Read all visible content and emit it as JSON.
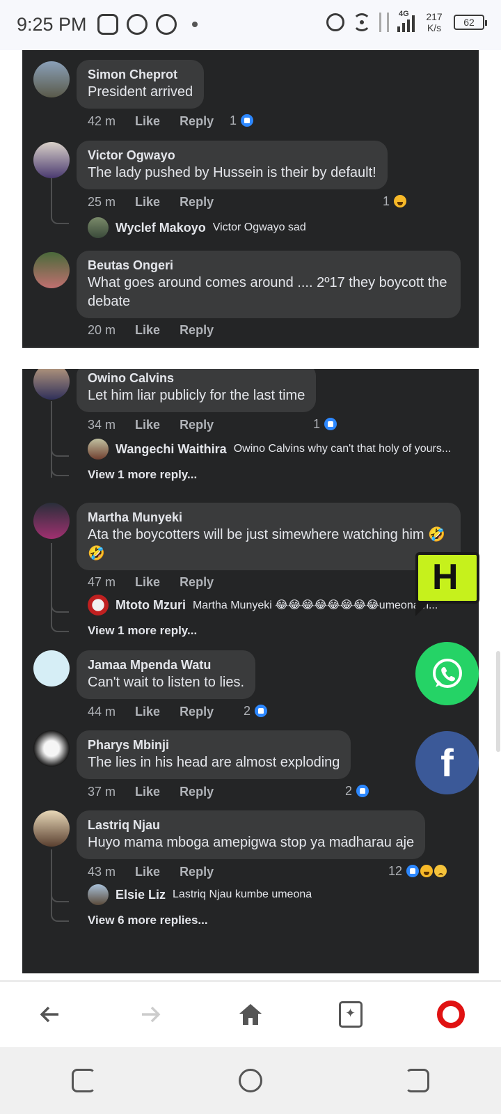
{
  "status_bar": {
    "time": "9:25 PM",
    "network": "4G",
    "speed_value": "217",
    "speed_unit": "K/s",
    "battery": "62"
  },
  "comments_top": [
    {
      "author": "Simon Cheprot",
      "text": "President arrived",
      "time": "42 m",
      "like": "Like",
      "reply": "Reply",
      "reactions": "1"
    },
    {
      "author": "Victor Ogwayo",
      "text": "The lady pushed by Hussein is their by default!",
      "time": "25 m",
      "like": "Like",
      "reply": "Reply",
      "reactions": "1",
      "sub_reply": {
        "author": "Wyclef Makoyo",
        "text": "Victor Ogwayo sad"
      }
    },
    {
      "author": "Beutas Ongeri",
      "text": "What goes around comes around .... 2º17 they boycott the debate",
      "time": "20 m",
      "like": "Like",
      "reply": "Reply"
    }
  ],
  "comments_bottom": [
    {
      "author": "Owino Calvins",
      "text": "Let him liar publicly for the last time",
      "time": "34 m",
      "like": "Like",
      "reply": "Reply",
      "reactions": "1",
      "sub_reply": {
        "author": "Wangechi Waithira",
        "text": "Owino Calvins why can't that holy of yours..."
      },
      "more": "View 1 more reply..."
    },
    {
      "author": "Martha Munyeki",
      "text": "Ata the boycotters will be just simewhere watching him 🤣🤣",
      "time": "47 m",
      "like": "Like",
      "reply": "Reply",
      "sub_reply": {
        "author": "Mtoto Mzuri",
        "text": "Martha Munyeki 😂😂😂😂😂😂😂😂umeona h..."
      },
      "more": "View 1 more reply..."
    },
    {
      "author": "Jamaa Mpenda Watu",
      "text": "Can't wait to listen to lies.",
      "time": "44 m",
      "like": "Like",
      "reply": "Reply",
      "reactions": "2"
    },
    {
      "author": "Pharys Mbinji",
      "text": "The lies in his head are almost exploding",
      "time": "37 m",
      "like": "Like",
      "reply": "Reply",
      "reactions": "2"
    },
    {
      "author": "Lastriq Njau",
      "text": "Huyo mama mboga amepigwa stop ya madharau aje",
      "time": "43 m",
      "like": "Like",
      "reply": "Reply",
      "reactions": "12",
      "sub_reply": {
        "author": "Elsie Liz",
        "text": "Lastriq Njau kumbe umeona"
      },
      "more": "View 6 more replies..."
    }
  ],
  "floating": {
    "h_logo": "H",
    "fb": "f"
  },
  "icons": {
    "back": "arrow-left-icon",
    "forward": "arrow-right-icon",
    "home": "home-icon",
    "tabs": "tabs-icon",
    "opera": "opera-logo-icon",
    "like_color": "#2d88ff",
    "whatsapp_color": "#25d366",
    "facebook_color": "#3b5998"
  }
}
